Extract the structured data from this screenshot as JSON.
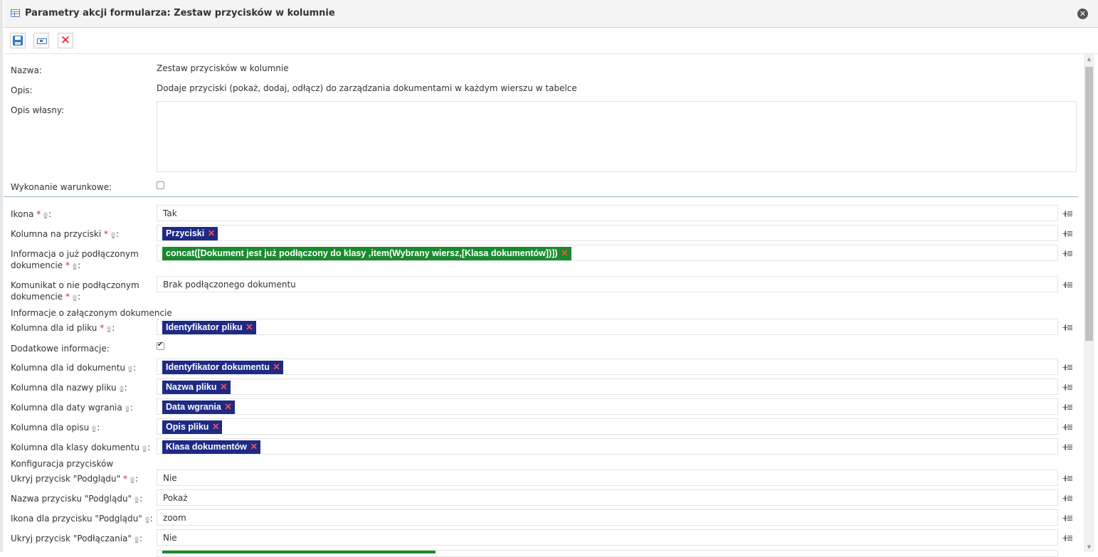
{
  "window": {
    "title": "Parametry akcji formularza: Zestaw przycisków w kolumnie"
  },
  "toolbar": {
    "save_icon": "save-icon",
    "rename_icon": "rename-icon",
    "delete_icon": "delete-icon"
  },
  "header": {
    "name_label": "Nazwa:",
    "name_value": "Zestaw przycisków w kolumnie",
    "desc_label": "Opis:",
    "desc_value": "Dodaje przyciski (pokaż, dodaj, odłącz) do zarządzania dokumentami w każdym wierszu w tabelce",
    "own_desc_label": "Opis własny:",
    "own_desc_value": "",
    "conditional_label": "Wykonanie warunkowe:",
    "conditional_checked": false
  },
  "fields": {
    "ikona": {
      "label": "Ikona",
      "value": "Tak"
    },
    "kolumna_przyciski": {
      "label": "Kolumna na przyciski",
      "tag": "Przyciski"
    },
    "info_podlaczony": {
      "label_line1": "Informacja o już podłączonym",
      "label_line2": "dokumencie",
      "tag": "concat([Dokument jest już podłączony do klasy ,item(Wybrany wiersz,[Klasa dokumentów])])"
    },
    "komunikat_nie": {
      "label_line1": "Komunikat o nie podłączonym",
      "label_line2": "dokumencie",
      "value": "Brak podłączonego dokumentu"
    },
    "section_zalaczony": "Informacje o załączonym dokumencie",
    "kolumna_id_pliku": {
      "label": "Kolumna dla id pliku",
      "tag": "Identyfikator pliku"
    },
    "dodatkowe": {
      "label": "Dodatkowe informacje:",
      "checked": true
    },
    "kolumna_id_dok": {
      "label": "Kolumna dla id dokumentu",
      "tag": "Identyfikator dokumentu"
    },
    "kolumna_nazwy": {
      "label": "Kolumna dla nazwy pliku",
      "tag": "Nazwa pliku"
    },
    "kolumna_daty": {
      "label": "Kolumna dla daty wgrania",
      "tag": "Data wgrania"
    },
    "kolumna_opisu": {
      "label": "Kolumna dla opisu",
      "tag": "Opis pliku"
    },
    "kolumna_klasy": {
      "label": "Kolumna dla klasy dokumentu",
      "tag": "Klasa dokumentów"
    },
    "section_konfig": "Konfiguracja przycisków",
    "ukryj_podgladu": {
      "label": "Ukryj przycisk \"Podglądu\"",
      "value": "Nie"
    },
    "nazwa_podgladu": {
      "label": "Nazwa przycisku \"Podglądu\"",
      "value": "Pokaż"
    },
    "ikona_podgladu": {
      "label": "Ikona dla przycisku \"Podglądu\"",
      "value": "zoom"
    },
    "ukryj_podlaczania": {
      "label": "Ukryj przycisk \"Podłączania\"",
      "value": "Nie"
    }
  },
  "common": {
    "required_mark": "*",
    "colon": ":",
    "remove_mark": "✕",
    "close_mark": "✕"
  }
}
